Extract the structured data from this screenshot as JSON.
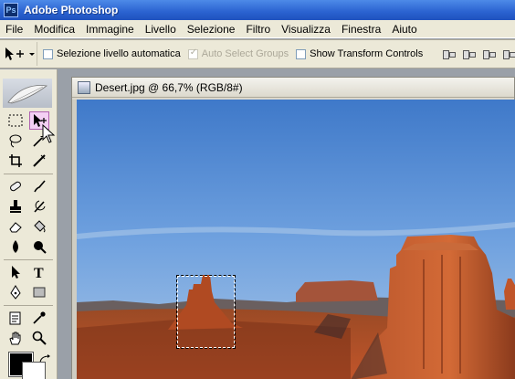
{
  "app": {
    "title": "Adobe Photoshop",
    "icon": "ps-app-icon"
  },
  "menu": {
    "items": [
      "File",
      "Modifica",
      "Immagine",
      "Livello",
      "Selezione",
      "Filtro",
      "Visualizza",
      "Finestra",
      "Aiuto"
    ]
  },
  "options": {
    "auto_select_layer": {
      "label": "Selezione livello automatica",
      "checked": false
    },
    "auto_select_groups": {
      "label": "Auto Select Groups",
      "checked": true,
      "disabled": true
    },
    "show_transform_controls": {
      "label": "Show Transform Controls",
      "checked": false
    }
  },
  "document": {
    "title": "Desert.jpg @ 66,7% (RGB/8#)",
    "zoom_percent": 66.7,
    "color_mode": "RGB/8#"
  },
  "toolbox": {
    "active_tool": "move-tool",
    "foreground_color": "#000000",
    "background_color": "#ffffff"
  },
  "colors": {
    "titlebar": "#2a62d0",
    "chrome": "#ece9d8",
    "active_tool_highlight": "#f4d0f4"
  }
}
